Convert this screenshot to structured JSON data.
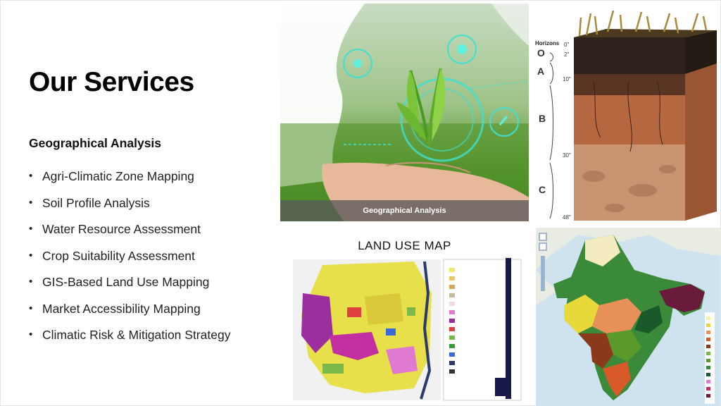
{
  "slide": {
    "title": "Our Services",
    "subtitle": "Geographical Analysis",
    "services": [
      "Agri-Climatic Zone Mapping",
      "Soil Profile Analysis",
      "Water Resource Assessment",
      "Crop Suitability Assessment",
      "GIS-Based Land Use Mapping",
      "Market Accessibility Mapping",
      "Climatic Risk & Mitigation Strategy"
    ],
    "bullet": "•"
  },
  "images": {
    "agri_caption": "Geographical Analysis",
    "soil": {
      "heading": "Horizons",
      "horizons": [
        "O",
        "A",
        "B",
        "C"
      ],
      "depths": [
        "0\"",
        "2\"",
        "10\"",
        "30\"",
        "48\""
      ]
    },
    "land_use_title": "LAND USE MAP"
  },
  "colors": {
    "title": "#000000",
    "text": "#222222",
    "caption_bar": "#5a5a5a"
  }
}
